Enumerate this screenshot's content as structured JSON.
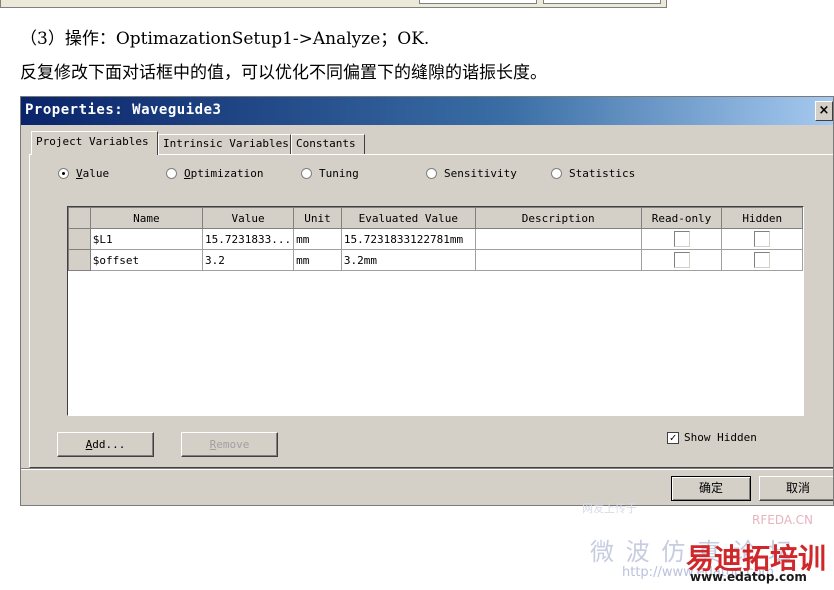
{
  "doc": {
    "line1": "（3）操作：OptimazationSetup1->Analyze；OK.",
    "line2": "反复修改下面对话框中的值，可以优化不同偏置下的缝隙的谐振长度。"
  },
  "dialog": {
    "title": "Properties: Waveguide3",
    "close_glyph": "×",
    "tabs": [
      "Project Variables",
      "Intrinsic Variables",
      "Constants"
    ],
    "radios": [
      {
        "mnemonic": "V",
        "rest": "alue",
        "selected": true
      },
      {
        "mnemonic": "O",
        "rest": "ptimization",
        "selected": false
      },
      {
        "mnemonic": "",
        "rest": "Tuning",
        "selected": false
      },
      {
        "mnemonic": "",
        "rest": "Sensitivity",
        "selected": false
      },
      {
        "mnemonic": "",
        "rest": "Statistics",
        "selected": false
      }
    ],
    "table": {
      "columns": [
        "Name",
        "Value",
        "Unit",
        "Evaluated Value",
        "Description",
        "Read-only",
        "Hidden"
      ],
      "rows": [
        {
          "name": "$L1",
          "value": "15.7231833...",
          "unit": "mm",
          "evaluated": "15.7231833122781mm",
          "description": "",
          "read_only": false,
          "hidden": false
        },
        {
          "name": "$offset",
          "value": "3.2",
          "unit": "mm",
          "evaluated": "3.2mm",
          "description": "",
          "read_only": false,
          "hidden": false
        }
      ]
    },
    "add_mnemonic": "A",
    "add_rest": "dd...",
    "remove_mnemonic": "R",
    "remove_rest": "emove",
    "show_hidden_label": "Show Hidden",
    "show_hidden_checked": true,
    "ok_label": "确定",
    "cancel_label": "取消"
  },
  "watermark": {
    "top_faint": "网友上传于",
    "rfeda": "RFEDA.CN",
    "weibo": "微 波 仿 真 论 坛",
    "url": "http://www.edatop.com",
    "brand_cn": "易迪拓培训",
    "brand_url": "www.edatop.com"
  },
  "colors": {
    "title_start": "#0a246a",
    "title_end": "#a6caf0",
    "dialog_face": "#d4d0c8",
    "brand_red": "#d0282a"
  }
}
